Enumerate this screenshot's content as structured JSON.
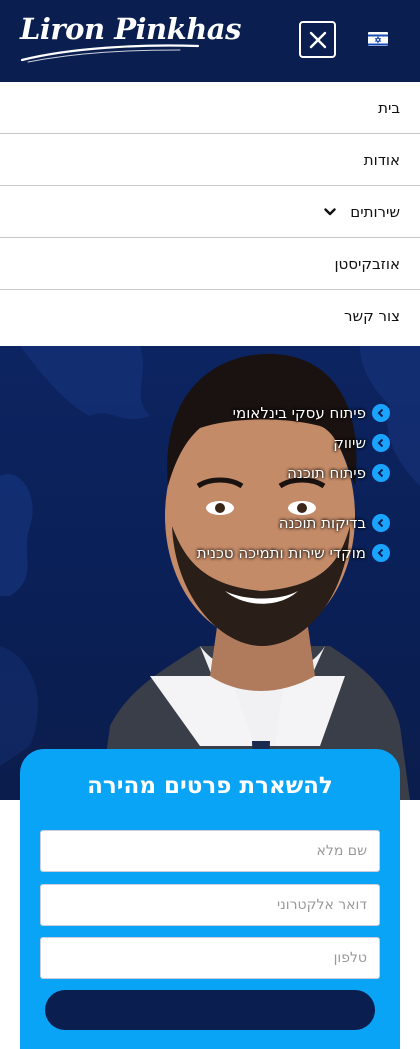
{
  "header": {
    "logo_text": "Liron Pinkhas",
    "close_icon": "close-icon",
    "flag_icon": "israel-flag-icon"
  },
  "menu": {
    "items": [
      {
        "label": "בית"
      },
      {
        "label": "אודות"
      },
      {
        "label": "שירותים",
        "icon": "chevron-down-icon"
      },
      {
        "label": "אוזבקיסטן"
      },
      {
        "label": "צור קשר"
      }
    ]
  },
  "hero": {
    "services": [
      "פיתוח עסקי בינלאומי",
      "שיווק",
      "פיתוח תוכנה",
      "בדיקות תוכנה",
      "מוקדי שירות ותמיכה טכנית"
    ],
    "bullet_icon": "chevron-left-circle-icon"
  },
  "form": {
    "title": "להשארת פרטים מהירה",
    "fields": [
      {
        "placeholder": "שם מלא"
      },
      {
        "placeholder": "דואר אלקטרוני"
      },
      {
        "placeholder": "טלפון"
      }
    ]
  },
  "colors": {
    "navy": "#0a1e50",
    "accent_blue": "#0aa4f6",
    "bullet_blue": "#1aa3ff"
  }
}
